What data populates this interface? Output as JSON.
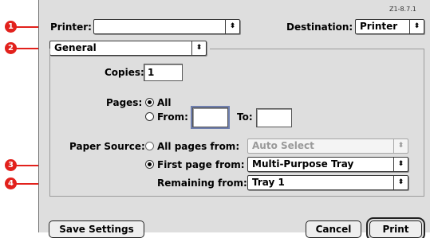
{
  "version_tag": "Z1-8.7.1",
  "printer": {
    "label": "Printer:",
    "value": ""
  },
  "destination": {
    "label": "Destination:",
    "value": "Printer"
  },
  "panel_menu": {
    "value": "General"
  },
  "copies": {
    "label": "Copies:",
    "value": "1"
  },
  "pages": {
    "label": "Pages:",
    "all_label": "All",
    "from_label": "From:",
    "from_value": "",
    "to_label": "To:",
    "to_value": "",
    "selected": "All"
  },
  "paper_source": {
    "label": "Paper Source:",
    "all_pages_label": "All pages from:",
    "all_pages_value": "Auto Select",
    "first_page_label": "First page from:",
    "first_page_value": "Multi-Purpose Tray",
    "remaining_label": "Remaining from:",
    "remaining_value": "Tray 1",
    "selected": "First page from"
  },
  "buttons": {
    "save": "Save Settings",
    "cancel": "Cancel",
    "print": "Print"
  },
  "callouts": [
    "1",
    "2",
    "3",
    "4"
  ],
  "colors": {
    "callout": "#e2211c",
    "dialog_bg": "#dedede",
    "focus_ring": "#6f7fae"
  },
  "arrow_glyph": "⬍"
}
